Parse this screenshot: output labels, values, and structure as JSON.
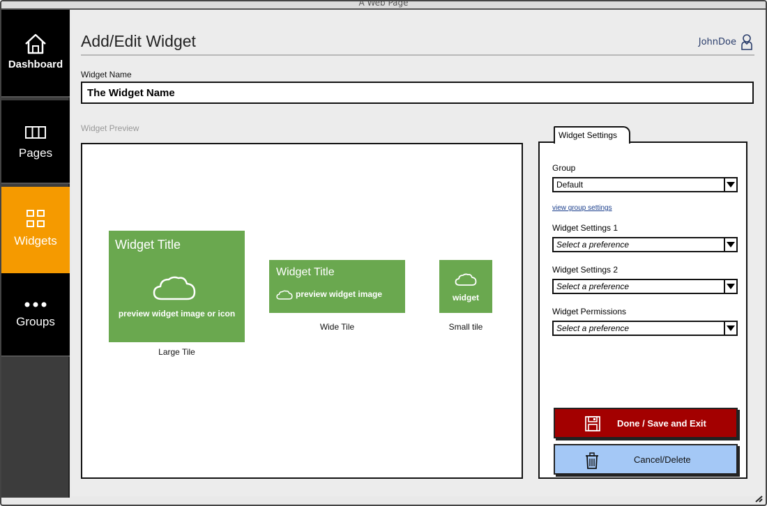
{
  "window": {
    "title": "A Web Page"
  },
  "sidebar": {
    "items": [
      {
        "label": "Dashboard",
        "icon": "home-icon"
      },
      {
        "label": "Pages",
        "icon": "pages-icon"
      },
      {
        "label": "Widgets",
        "icon": "widgets-grid-icon",
        "active": true
      },
      {
        "label": "Groups",
        "icon": "more-dots-icon"
      }
    ],
    "active_color": "#f59a00"
  },
  "header": {
    "title": "Add/Edit Widget",
    "user_name": "JohnDoe",
    "user_icon": "user-icon"
  },
  "form": {
    "widget_name_label": "Widget Name",
    "widget_name_value": "The Widget Name"
  },
  "preview": {
    "label": "Widget Preview",
    "tile_color": "#6aa84f",
    "large": {
      "title": "Widget Title",
      "text": "preview widget image or icon",
      "caption": "Large Tile",
      "icon": "cloud-icon"
    },
    "wide": {
      "title": "Widget Title",
      "text": "preview widget image",
      "caption": "Wide Tile",
      "icon": "cloud-icon"
    },
    "small": {
      "text": "widget",
      "caption": "Small tile",
      "icon": "cloud-icon"
    }
  },
  "settings": {
    "tab_label": "Widget Settings",
    "group": {
      "label": "Group",
      "value": "Default",
      "link": "view group settings"
    },
    "setting1": {
      "label": "Widget Settings 1",
      "value": "Select a preference"
    },
    "setting2": {
      "label": "Widget Settings 2",
      "value": "Select a preference"
    },
    "permissions": {
      "label": "Widget Permissions",
      "value": "Select a preference"
    },
    "done_button": {
      "label": "Done / Save and Exit",
      "icon": "save-floppy-icon",
      "color": "#a30000"
    },
    "cancel_button": {
      "label": "Cancel/Delete",
      "icon": "trash-icon",
      "color": "#a4c8f6"
    }
  }
}
